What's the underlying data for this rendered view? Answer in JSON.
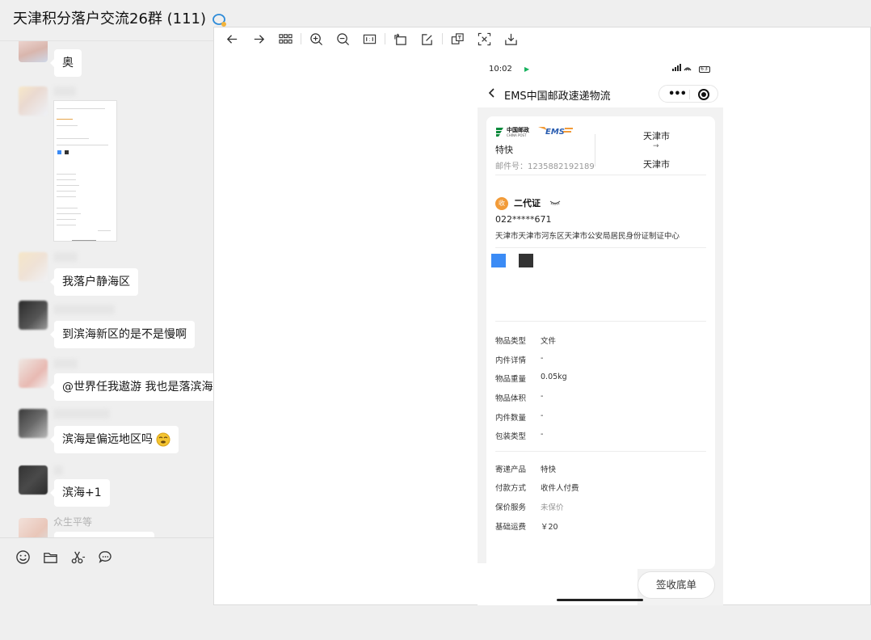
{
  "chat": {
    "title": "天津积分落户交流26群 (111)",
    "messages": [
      {
        "text": "奥"
      },
      {
        "text": "我落户静海区"
      },
      {
        "text": "到滨海新区的是不是慢啊"
      },
      {
        "text": "@世界任我遨游 我也是落滨海"
      },
      {
        "text": "滨海是偏远地区吗"
      },
      {
        "text": "滨海+1"
      }
    ],
    "last_sender": "众生平等",
    "input_tools": [
      "emoji-icon",
      "folder-icon",
      "scissors-icon",
      "chat-bubble-icon"
    ]
  },
  "viewer": {
    "toolbar": [
      "back-arrow-icon",
      "forward-arrow-icon",
      "grid-icon",
      "zoom-in-icon",
      "zoom-out-icon",
      "actual-size-icon",
      "rotate-icon",
      "edit-icon",
      "translate-icon",
      "extract-text-icon",
      "download-icon"
    ]
  },
  "phone": {
    "status_time": "10:02",
    "status_battery": "63",
    "nav_title": "EMS中国邮政速递物流",
    "logo_text": "中国邮政",
    "logo_sub": "CHINA POST",
    "logo_ems": "EMS",
    "service": "特快",
    "tracking_label": "邮件号：",
    "tracking_number": "1235882192189",
    "route_from": "天津市",
    "route_arrow": "→",
    "route_to": "天津市",
    "badge": "收",
    "recipient_name": "二代证",
    "recipient_phone": "022*****671",
    "recipient_address": "天津市天津市河东区天津市公安局居民身份证制证中心",
    "fields": [
      {
        "label": "物品类型",
        "value": "文件"
      },
      {
        "label": "内件详情",
        "value": "-"
      },
      {
        "label": "物品重量",
        "value": "0.05kg"
      },
      {
        "label": "物品体积",
        "value": "-"
      },
      {
        "label": "内件数量",
        "value": "-"
      },
      {
        "label": "包装类型",
        "value": "-"
      }
    ],
    "fields2": [
      {
        "label": "寄递产品",
        "value": "特快"
      },
      {
        "label": "付款方式",
        "value": "收件人付费"
      },
      {
        "label": "保价服务",
        "value": "未保价"
      },
      {
        "label": "基础运费",
        "value": "￥20"
      }
    ],
    "sign_button": "签收底单"
  }
}
